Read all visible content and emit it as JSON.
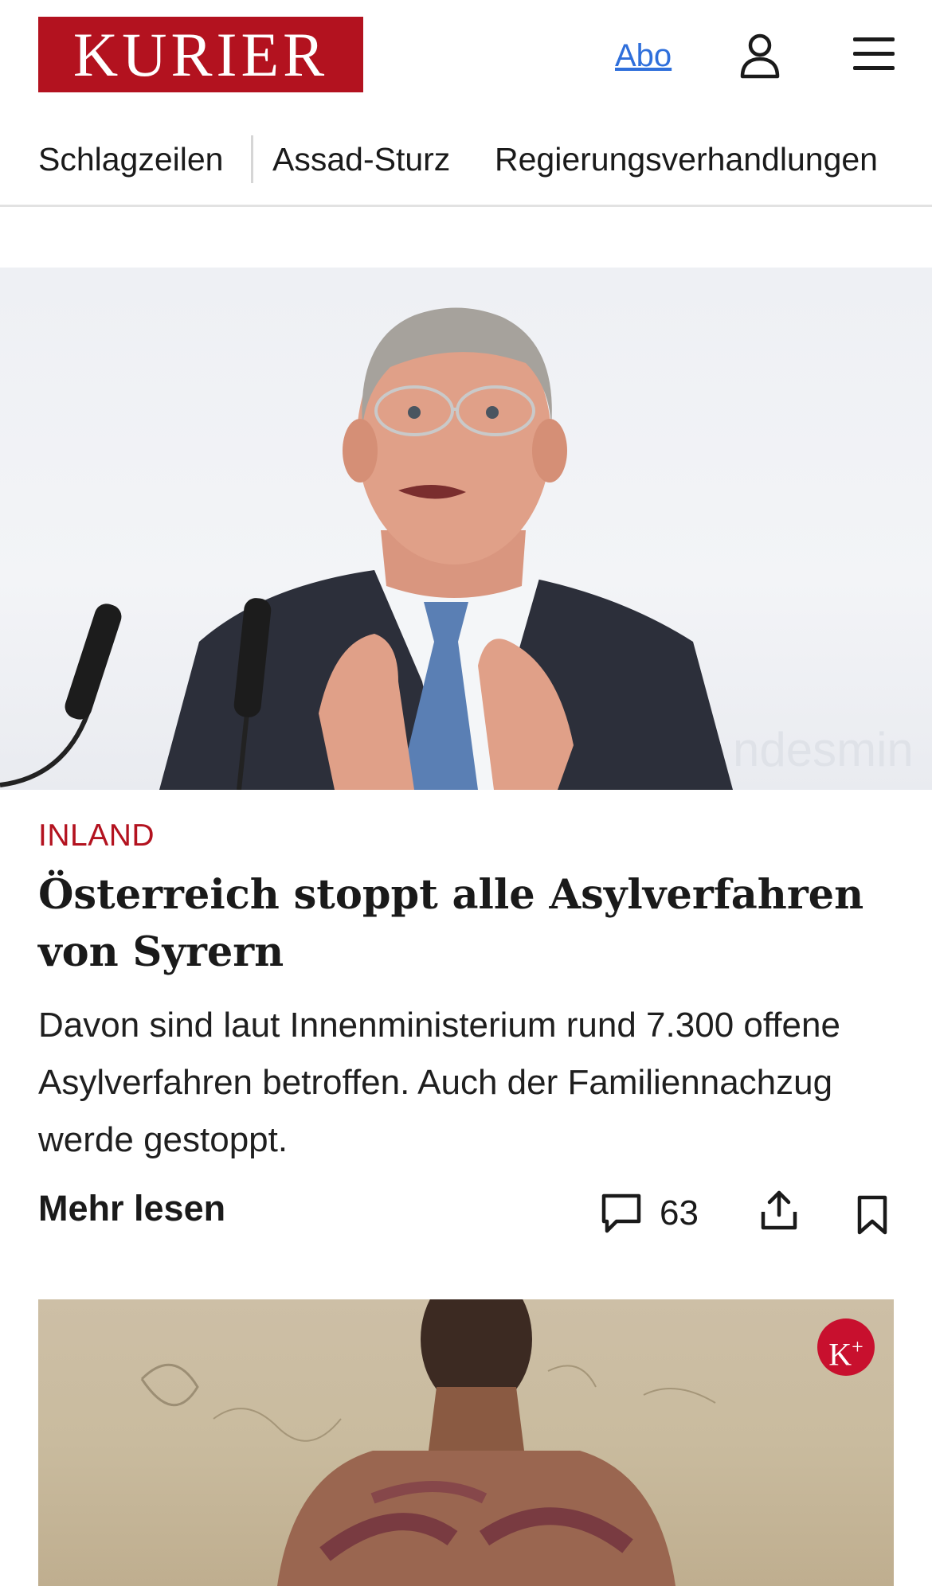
{
  "header": {
    "logo_text": "KURIER",
    "abo_label": "Abo",
    "user_icon": "user-icon",
    "menu_icon": "menu-icon"
  },
  "category_nav": {
    "items": [
      {
        "label": "Schlagzeilen"
      },
      {
        "label": "Assad-Sturz"
      },
      {
        "label": "Regierungsverhandlungen"
      }
    ]
  },
  "lead_article": {
    "kicker": "INLAND",
    "headline": "Österreich stoppt alle Asylverfahren von Syrern",
    "teaser": "Davon sind laut Innenministerium rund 7.300 offene Asylverfahren betroffen. Auch der Familiennachzug werde gestoppt.",
    "more_label": "Mehr lesen",
    "comment_count": "63",
    "image_watermark": "ndesmin"
  },
  "second_article": {
    "badge": "K",
    "badge_plus": "+"
  },
  "colors": {
    "brand_red": "#b3121f",
    "link_blue": "#2f6fdb",
    "text": "#1a1a1a"
  }
}
